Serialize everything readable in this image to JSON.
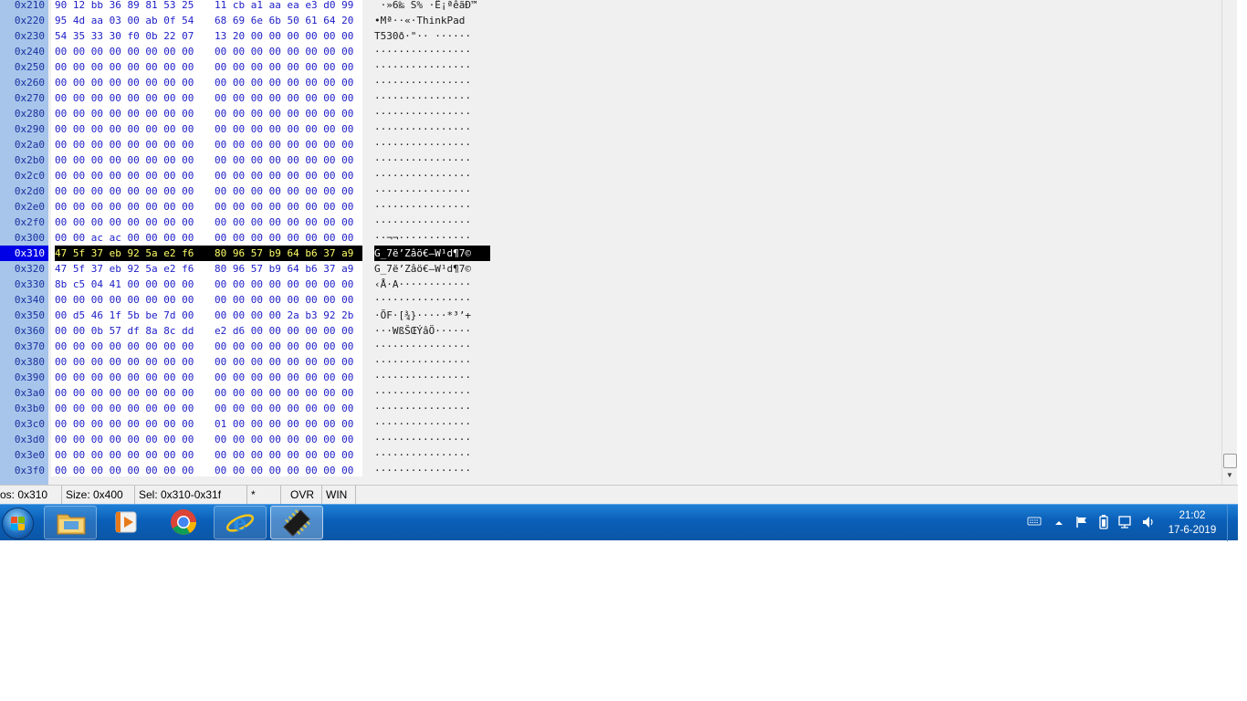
{
  "hexview": {
    "rows": [
      {
        "offset": "0x210",
        "hex1": "90 12 bb 36 89 81 53 25",
        "hex2": "11 cb a1 aa ea e3 d0 99",
        "ascii": " ·»6‰ S% ·Ë¡ªêãÐ™",
        "selected": false
      },
      {
        "offset": "0x220",
        "hex1": "95 4d aa 03 00 ab 0f 54",
        "hex2": "68 69 6e 6b 50 61 64 20",
        "ascii": "•Mª··«·ThinkPad ",
        "selected": false
      },
      {
        "offset": "0x230",
        "hex1": "54 35 33 30 f0 0b 22 07",
        "hex2": "13 20 00 00 00 00 00 00",
        "ascii": "T530ð·\"·· ······",
        "selected": false
      },
      {
        "offset": "0x240",
        "hex1": "00 00 00 00 00 00 00 00",
        "hex2": "00 00 00 00 00 00 00 00",
        "ascii": "················",
        "selected": false
      },
      {
        "offset": "0x250",
        "hex1": "00 00 00 00 00 00 00 00",
        "hex2": "00 00 00 00 00 00 00 00",
        "ascii": "················",
        "selected": false
      },
      {
        "offset": "0x260",
        "hex1": "00 00 00 00 00 00 00 00",
        "hex2": "00 00 00 00 00 00 00 00",
        "ascii": "················",
        "selected": false
      },
      {
        "offset": "0x270",
        "hex1": "00 00 00 00 00 00 00 00",
        "hex2": "00 00 00 00 00 00 00 00",
        "ascii": "················",
        "selected": false
      },
      {
        "offset": "0x280",
        "hex1": "00 00 00 00 00 00 00 00",
        "hex2": "00 00 00 00 00 00 00 00",
        "ascii": "················",
        "selected": false
      },
      {
        "offset": "0x290",
        "hex1": "00 00 00 00 00 00 00 00",
        "hex2": "00 00 00 00 00 00 00 00",
        "ascii": "················",
        "selected": false
      },
      {
        "offset": "0x2a0",
        "hex1": "00 00 00 00 00 00 00 00",
        "hex2": "00 00 00 00 00 00 00 00",
        "ascii": "················",
        "selected": false
      },
      {
        "offset": "0x2b0",
        "hex1": "00 00 00 00 00 00 00 00",
        "hex2": "00 00 00 00 00 00 00 00",
        "ascii": "················",
        "selected": false
      },
      {
        "offset": "0x2c0",
        "hex1": "00 00 00 00 00 00 00 00",
        "hex2": "00 00 00 00 00 00 00 00",
        "ascii": "················",
        "selected": false
      },
      {
        "offset": "0x2d0",
        "hex1": "00 00 00 00 00 00 00 00",
        "hex2": "00 00 00 00 00 00 00 00",
        "ascii": "················",
        "selected": false
      },
      {
        "offset": "0x2e0",
        "hex1": "00 00 00 00 00 00 00 00",
        "hex2": "00 00 00 00 00 00 00 00",
        "ascii": "················",
        "selected": false
      },
      {
        "offset": "0x2f0",
        "hex1": "00 00 00 00 00 00 00 00",
        "hex2": "00 00 00 00 00 00 00 00",
        "ascii": "················",
        "selected": false
      },
      {
        "offset": "0x300",
        "hex1": "00 00 ac ac 00 00 00 00",
        "hex2": "00 00 00 00 00 00 00 00",
        "ascii": "··¬¬············",
        "selected": false
      },
      {
        "offset": "0x310",
        "hex1": "47 5f 37 eb 92 5a e2 f6",
        "hex2": "80 96 57 b9 64 b6 37 a9",
        "ascii": "G_7ë’Zâö€–W¹d¶7©",
        "selected": true
      },
      {
        "offset": "0x320",
        "hex1": "47 5f 37 eb 92 5a e2 f6",
        "hex2": "80 96 57 b9 64 b6 37 a9",
        "ascii": "G_7ë’Zâö€–W¹d¶7©",
        "selected": false
      },
      {
        "offset": "0x330",
        "hex1": "8b c5 04 41 00 00 00 00",
        "hex2": "00 00 00 00 00 00 00 00",
        "ascii": "‹Å·A············",
        "selected": false
      },
      {
        "offset": "0x340",
        "hex1": "00 00 00 00 00 00 00 00",
        "hex2": "00 00 00 00 00 00 00 00",
        "ascii": "················",
        "selected": false
      },
      {
        "offset": "0x350",
        "hex1": "00 d5 46 1f 5b be 7d 00",
        "hex2": "00 00 00 00 2a b3 92 2b",
        "ascii": "·ÕF·[¾}·····*³’+",
        "selected": false
      },
      {
        "offset": "0x360",
        "hex1": "00 00 0b 57 df 8a 8c dd",
        "hex2": "e2 d6 00 00 00 00 00 00",
        "ascii": "···WßŠŒÝâÖ······",
        "selected": false
      },
      {
        "offset": "0x370",
        "hex1": "00 00 00 00 00 00 00 00",
        "hex2": "00 00 00 00 00 00 00 00",
        "ascii": "················",
        "selected": false
      },
      {
        "offset": "0x380",
        "hex1": "00 00 00 00 00 00 00 00",
        "hex2": "00 00 00 00 00 00 00 00",
        "ascii": "················",
        "selected": false
      },
      {
        "offset": "0x390",
        "hex1": "00 00 00 00 00 00 00 00",
        "hex2": "00 00 00 00 00 00 00 00",
        "ascii": "················",
        "selected": false
      },
      {
        "offset": "0x3a0",
        "hex1": "00 00 00 00 00 00 00 00",
        "hex2": "00 00 00 00 00 00 00 00",
        "ascii": "················",
        "selected": false
      },
      {
        "offset": "0x3b0",
        "hex1": "00 00 00 00 00 00 00 00",
        "hex2": "00 00 00 00 00 00 00 00",
        "ascii": "················",
        "selected": false
      },
      {
        "offset": "0x3c0",
        "hex1": "00 00 00 00 00 00 00 00",
        "hex2": "01 00 00 00 00 00 00 00",
        "ascii": "················",
        "selected": false
      },
      {
        "offset": "0x3d0",
        "hex1": "00 00 00 00 00 00 00 00",
        "hex2": "00 00 00 00 00 00 00 00",
        "ascii": "················",
        "selected": false
      },
      {
        "offset": "0x3e0",
        "hex1": "00 00 00 00 00 00 00 00",
        "hex2": "00 00 00 00 00 00 00 00",
        "ascii": "················",
        "selected": false
      },
      {
        "offset": "0x3f0",
        "hex1": "00 00 00 00 00 00 00 00",
        "hex2": "00 00 00 00 00 00 00 00",
        "ascii": "················",
        "selected": false
      }
    ]
  },
  "statusbar": {
    "pos": "os: 0x310",
    "size": "Size: 0x400",
    "sel": "Sel: 0x310-0x31f",
    "modified": "*",
    "mode": "OVR",
    "charset": "WIN"
  },
  "taskbar": {
    "apps": [
      {
        "name": "file-explorer",
        "icon": "folder-icon"
      },
      {
        "name": "media-player",
        "icon": "media-player-icon"
      },
      {
        "name": "chrome",
        "icon": "chrome-icon"
      },
      {
        "name": "internet-explorer",
        "icon": "internet-explorer-icon"
      },
      {
        "name": "hex-editor",
        "icon": "chip-icon",
        "active": true
      }
    ],
    "tray": [
      "keyboard-icon",
      "chevron-up-icon",
      "flag-icon",
      "battery-icon",
      "network-icon",
      "volume-icon"
    ],
    "clock": {
      "time": "21:02",
      "date": "17-6-2019"
    }
  },
  "colors": {
    "offset_column": "#a7c5ea",
    "hex_text": "#1c1cc8",
    "selection_bg": "#000000",
    "selection_hex": "#ffff66",
    "selected_offset_bg": "#0000e6",
    "taskbar": "#0a5fb8"
  }
}
